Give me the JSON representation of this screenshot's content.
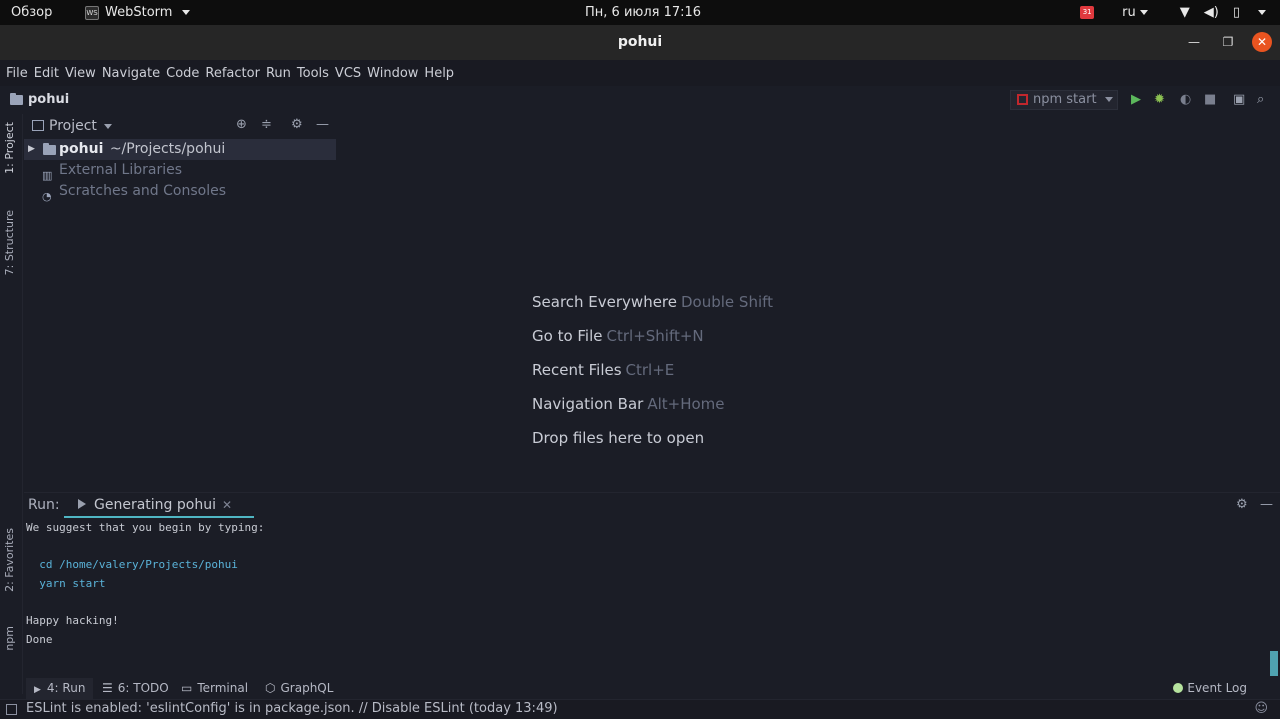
{
  "topbar": {
    "overview": "Обзор",
    "app_name": "WebStorm",
    "clock": "Пн, 6 июля  17:16",
    "calendar_badge": "31",
    "lang": "ru"
  },
  "window": {
    "title": "pohui"
  },
  "menu": [
    "File",
    "Edit",
    "View",
    "Navigate",
    "Code",
    "Refactor",
    "Run",
    "Tools",
    "VCS",
    "Window",
    "Help"
  ],
  "navbar": {
    "project": "pohui",
    "run_config": "npm start"
  },
  "sidebar": {
    "project_tab": "1: Project",
    "structure_tab": "7: Structure",
    "favorites_tab": "2: Favorites",
    "npm_tab": "npm"
  },
  "project_panel": {
    "title": "Project",
    "tree": [
      {
        "name": "pohui",
        "path": "~/Projects/pohui"
      },
      {
        "name": "External Libraries"
      },
      {
        "name": "Scratches and Consoles"
      }
    ]
  },
  "hints": [
    {
      "label": "Search Everywhere",
      "shortcut": "Double Shift"
    },
    {
      "label": "Go to File",
      "shortcut": "Ctrl+Shift+N"
    },
    {
      "label": "Recent Files",
      "shortcut": "Ctrl+E"
    },
    {
      "label": "Navigation Bar",
      "shortcut": "Alt+Home"
    },
    {
      "label": "Drop files here to open",
      "shortcut": ""
    }
  ],
  "run_window": {
    "label": "Run:",
    "tab": "Generating pohui",
    "console": [
      "We suggest that you begin by typing:",
      "",
      "  cd /home/valery/Projects/pohui",
      "  yarn start",
      "",
      "Happy hacking!",
      "Done"
    ]
  },
  "tool_tabs": [
    {
      "label": "4: Run"
    },
    {
      "label": "6: TODO"
    },
    {
      "label": "Terminal"
    },
    {
      "label": "GraphQL"
    }
  ],
  "event_log": "Event Log",
  "status": "ESLint is enabled: 'eslintConfig' is in package.json. // Disable ESLint (today 13:49)"
}
